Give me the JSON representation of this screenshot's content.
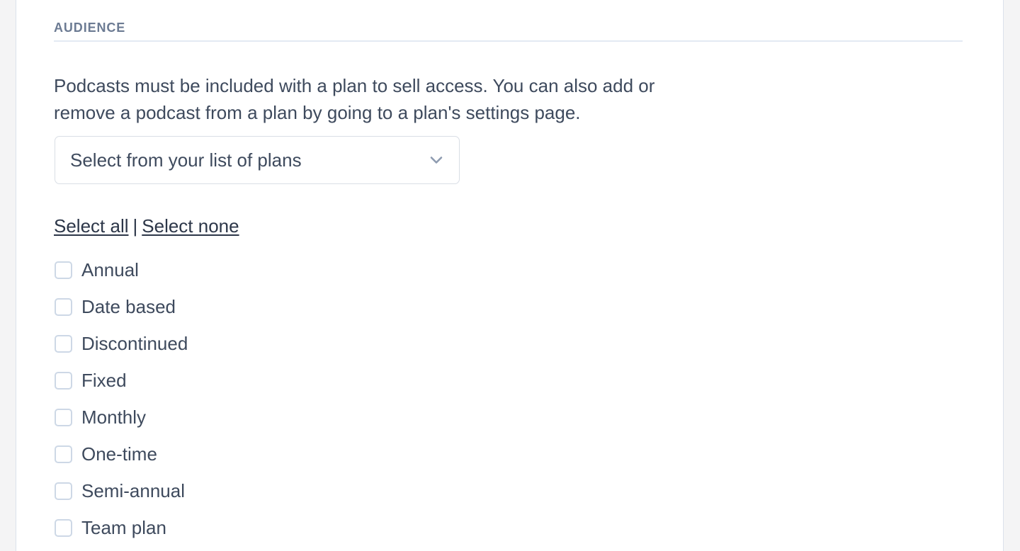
{
  "section": {
    "heading": "AUDIENCE",
    "intro": "Podcasts must be included with a plan to sell access. You can also add or remove a podcast from a plan by going to a plan's settings page."
  },
  "plan_select": {
    "value": "Select from your list of plans",
    "placeholder": "Select from your list of plans",
    "chevron_icon": "chevron-down-icon"
  },
  "bulk_actions": {
    "select_all": "Select all",
    "separator": "|",
    "select_none": "Select none"
  },
  "plan_checkboxes": [
    {
      "label": "Annual",
      "checked": false
    },
    {
      "label": "Date based",
      "checked": false
    },
    {
      "label": "Discontinued",
      "checked": false
    },
    {
      "label": "Fixed",
      "checked": false
    },
    {
      "label": "Monthly",
      "checked": false
    },
    {
      "label": "One-time",
      "checked": false
    },
    {
      "label": "Semi-annual",
      "checked": false
    },
    {
      "label": "Team plan",
      "checked": false
    }
  ],
  "colors": {
    "heading": "#6c7b93",
    "body_text": "#3e4a5d",
    "link_text": "#2c3648",
    "rule": "#e3eaf3",
    "border": "#d9dee5",
    "checkbox_border": "#cdd8e6",
    "page_background": "#f4f4f5",
    "panel_background": "#ffffff",
    "chevron": "#8e9bb0"
  }
}
